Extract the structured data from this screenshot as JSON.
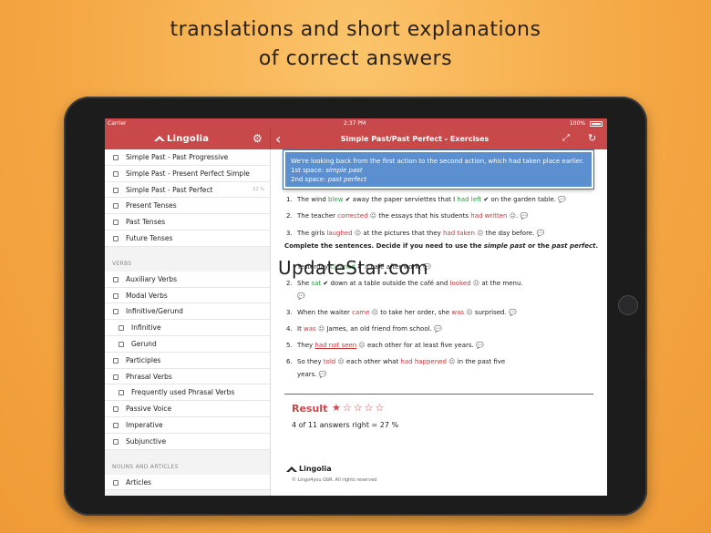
{
  "promo": {
    "line1": "translations and short explanations",
    "line2": "of correct answers"
  },
  "statusbar": {
    "carrier": "Carrier",
    "time": "2:37 PM",
    "battery": "100%"
  },
  "navbar": {
    "logo": "Lingolia",
    "title": "Simple Past/Past Perfect - Exercises"
  },
  "sidebar": {
    "top_items": [
      {
        "label": "Simple Past - Past Progressive"
      },
      {
        "label": "Simple Past - Present Perfect Simple"
      },
      {
        "label": "Simple Past - Past Perfect",
        "pct": "22 %"
      },
      {
        "label": "Present Tenses"
      },
      {
        "label": "Past Tenses"
      },
      {
        "label": "Future Tenses"
      }
    ],
    "section_verbs": "VERBS",
    "verb_items": [
      {
        "label": "Auxiliary Verbs",
        "sub": false
      },
      {
        "label": "Modal Verbs",
        "sub": false
      },
      {
        "label": "Infinitive/Gerund",
        "sub": false
      },
      {
        "label": "Infinitive",
        "sub": true
      },
      {
        "label": "Gerund",
        "sub": true
      },
      {
        "label": "Participles",
        "sub": false
      },
      {
        "label": "Phrasal Verbs",
        "sub": false
      },
      {
        "label": "Frequently used Phrasal Verbs",
        "sub": true
      },
      {
        "label": "Passive Voice",
        "sub": false
      },
      {
        "label": "Imperative",
        "sub": false
      },
      {
        "label": "Subjunctive",
        "sub": false
      }
    ],
    "section_nouns": "NOUNS AND ARTICLES",
    "noun_items": [
      {
        "label": "Articles"
      }
    ]
  },
  "tooltip": {
    "line1": "We're looking back from the first action to the second action, which had taken place earlier.",
    "line2_prefix": "1st space: ",
    "line2_value": "simple past",
    "line3_prefix": "2nd space: ",
    "line3_value": "past perfect"
  },
  "exercises_a": [
    {
      "num": "1.",
      "t1": "The wind ",
      "a1": "blew",
      "t2": " away the paper serviettes that I ",
      "a2": "had left",
      "t3": " on the garden table."
    },
    {
      "num": "2.",
      "t1": "The teacher ",
      "a1": "corrected",
      "t2": " the essays that his students ",
      "a2": "had written",
      "t3": "."
    },
    {
      "num": "3.",
      "t1": "The girls ",
      "a1": "laughed",
      "t2": " at the pictures that they ",
      "a2": "had taken",
      "t3": " the day before."
    }
  ],
  "instruction": {
    "prefix": "Complete the sentences. Decide if you need to use the ",
    "em1": "simple past",
    "mid": " or the ",
    "em2": "past perfect",
    "suffix": "."
  },
  "exercises_b": {
    "ex1": {
      "t1": "Yesterday",
      "a1": "cleaned",
      "t2": " a cafe after work."
    },
    "ex2": {
      "num": "2.",
      "t1": "She ",
      "a1": "sat",
      "t2": " down at a table outside the café and ",
      "a2": "looked",
      "t3": " at the menu."
    },
    "ex3": {
      "num": "3.",
      "t1": "When the waiter ",
      "a1": "came",
      "t2": " to take her order, she ",
      "a2": "was",
      "t3": " surprised."
    },
    "ex4": {
      "num": "4.",
      "t1": "It ",
      "a1": "was",
      "t2": " James, an old friend from school."
    },
    "ex5": {
      "num": "5.",
      "t1": "They ",
      "a1": "had not seen",
      "t2": " each other for at least five years."
    },
    "ex6": {
      "num": "6.",
      "t1": "So they ",
      "a1": "told",
      "t2": " each other what ",
      "a2": "had happened",
      "t3": " in the past five",
      "t4": "years."
    }
  },
  "result": {
    "label": "Result",
    "stars_filled": 1,
    "stars_total": 5,
    "score_text": "4 of 11 answers right = 27 %"
  },
  "footer": {
    "logo": "Lingolia",
    "copyright": "© Lingo4you GbR. All rights reserved"
  },
  "watermark": "UpdateStar.com",
  "colors": {
    "brand_red": "#c9484a",
    "correct_green": "#2d9a3e",
    "wrong_red": "#c23a3c",
    "tooltip_blue": "#5b8fcf"
  }
}
